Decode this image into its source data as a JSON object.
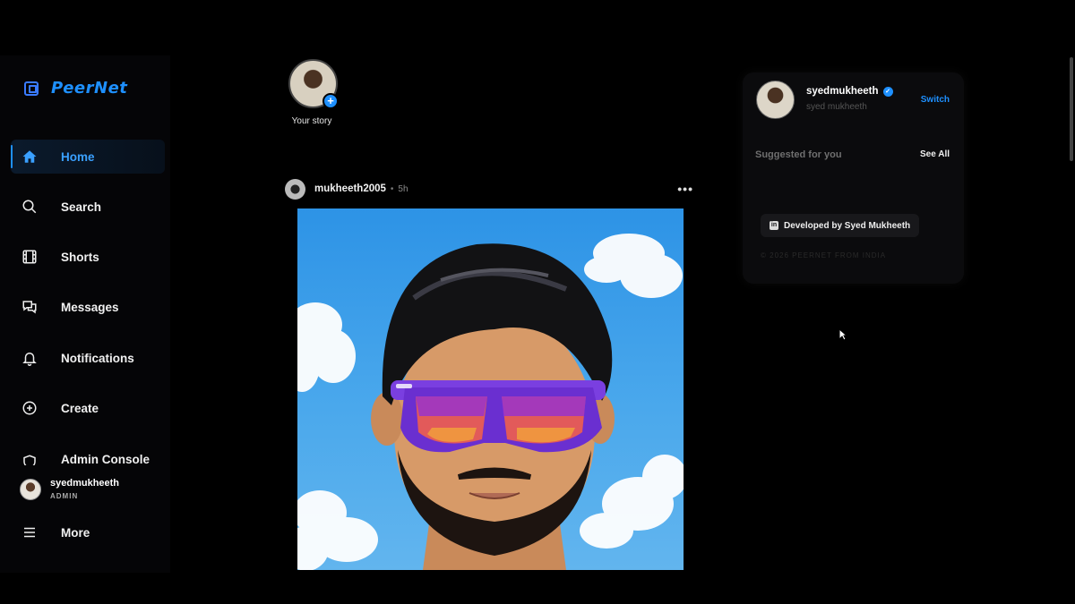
{
  "brand": {
    "name": "PeerNet"
  },
  "nav": [
    {
      "label": "Home",
      "icon": "home-icon",
      "active": true
    },
    {
      "label": "Search",
      "icon": "search-icon"
    },
    {
      "label": "Shorts",
      "icon": "film-icon"
    },
    {
      "label": "Messages",
      "icon": "messages-icon"
    },
    {
      "label": "Notifications",
      "icon": "bell-icon"
    },
    {
      "label": "Create",
      "icon": "plus-circle-icon"
    },
    {
      "label": "Admin Console",
      "icon": "shield-icon"
    },
    {
      "label": "More",
      "icon": "menu-icon"
    }
  ],
  "current_user": {
    "username": "syedmukheeth",
    "role": "ADMIN",
    "full_name": "syed mukheeth"
  },
  "story": {
    "label": "Your story"
  },
  "post": {
    "username": "mukheeth2005",
    "time": "5h"
  },
  "sidebar_card": {
    "switch_label": "Switch",
    "suggested_label": "Suggested for you",
    "see_all_label": "See All",
    "developed_by": "Developed by Syed Mukheeth",
    "footer": "© 2026 PEERNET FROM INDIA"
  },
  "colors": {
    "accent": "#1e90ff",
    "background": "#000000",
    "card": "#0b0b0d"
  }
}
